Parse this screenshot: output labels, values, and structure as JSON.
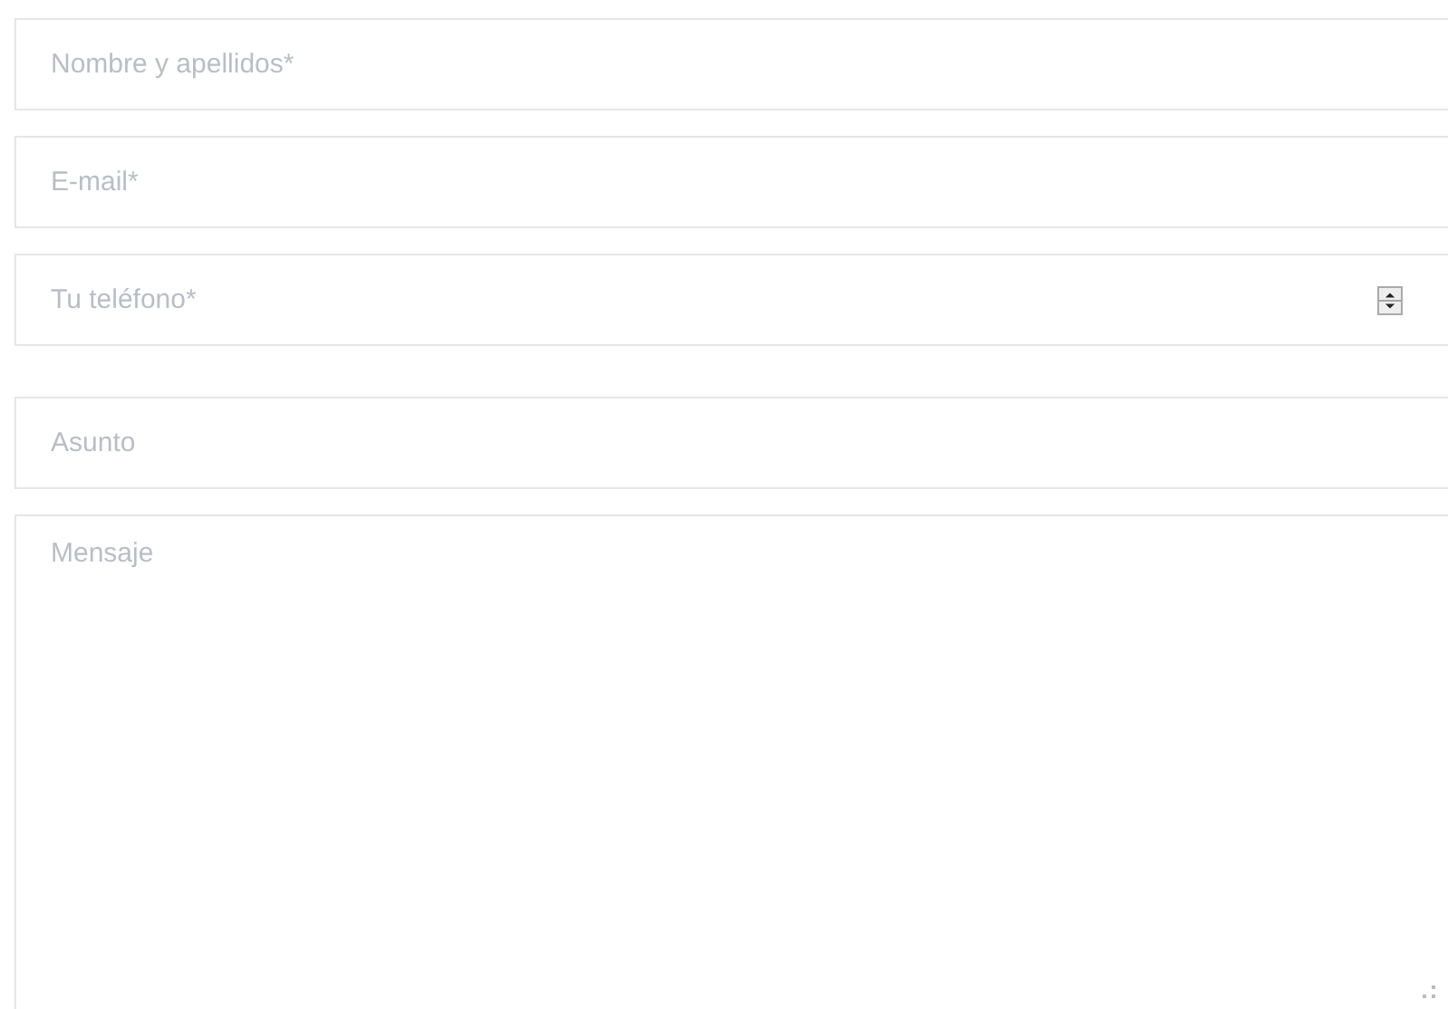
{
  "fields": [
    {
      "kind": "text",
      "placeholder": "Nombre y apellidos*"
    },
    {
      "kind": "text",
      "placeholder": "E-mail*"
    },
    {
      "kind": "number",
      "placeholder": "Tu teléfono*"
    },
    {
      "kind": "text",
      "placeholder": "Asunto"
    },
    {
      "kind": "textarea",
      "placeholder": "Mensaje"
    }
  ]
}
